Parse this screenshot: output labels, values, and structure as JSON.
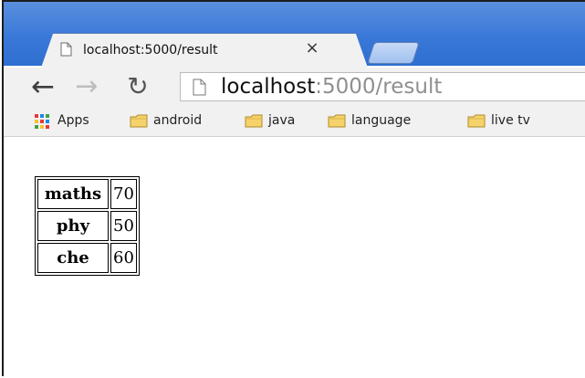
{
  "browser": {
    "tab_title": "localhost:5000/result",
    "tab_close_glyph": "×",
    "url_host": "localhost",
    "url_rest": ":5000/result",
    "back_icon": "back-arrow-icon",
    "forward_icon": "forward-arrow-icon",
    "reload_icon": "reload-icon",
    "page_icon": "page-icon",
    "apps_icon": "apps-grid-icon",
    "folder_icon": "folder-icon"
  },
  "bookmarks": [
    {
      "label": "Apps"
    },
    {
      "label": "android"
    },
    {
      "label": "java"
    },
    {
      "label": "language"
    },
    {
      "label": "live tv"
    }
  ],
  "result": {
    "rows": [
      {
        "subject": "maths",
        "score": "70"
      },
      {
        "subject": "phy",
        "score": "50"
      },
      {
        "subject": "che",
        "score": "60"
      }
    ]
  },
  "colors": {
    "titlebar": "#2d6fd1",
    "toolbar": "#f1f1f1",
    "text": "#111111",
    "folder_fill": "#f6d26a"
  }
}
